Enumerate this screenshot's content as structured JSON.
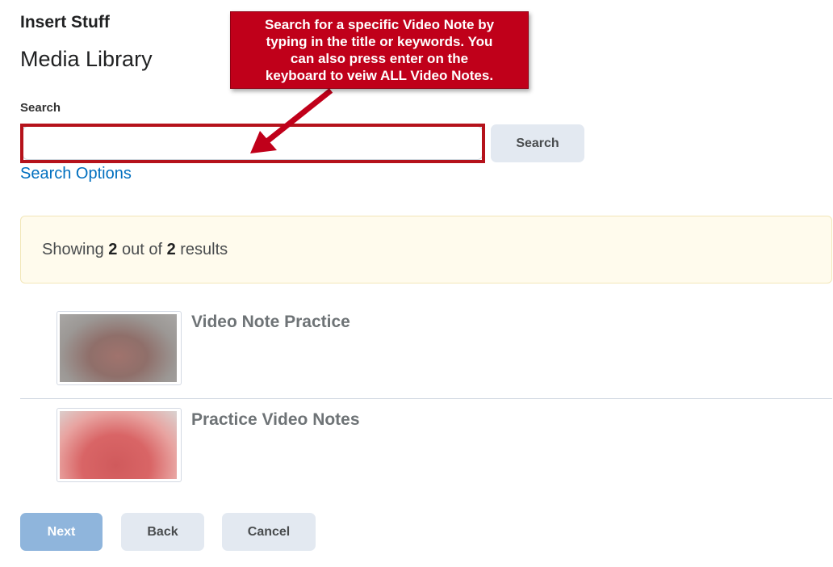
{
  "dialog": {
    "title": "Insert Stuff"
  },
  "page": {
    "title": "Media Library"
  },
  "search": {
    "label": "Search",
    "value": "",
    "placeholder": "",
    "button_label": "Search",
    "options_link": "Search Options"
  },
  "results": {
    "prefix": "Showing",
    "shown": "2",
    "middle": "out of",
    "total": "2",
    "suffix": "results"
  },
  "items": [
    {
      "title": "Video Note Practice",
      "thumbnail": "blurred-video-thumbnail"
    },
    {
      "title": "Practice Video Notes",
      "thumbnail": "blurred-video-thumbnail"
    }
  ],
  "footer": {
    "next_label": "Next",
    "back_label": "Back",
    "cancel_label": "Cancel"
  },
  "callout": {
    "text": "Search for a specific Video Note by\ntyping in the title or keywords. You\ncan also press enter on the\nkeyboard to veiw ALL  Video Notes."
  },
  "colors": {
    "accent": "#006fbf",
    "primary_button": "#8fb5dc",
    "secondary_button": "#e3e9f1",
    "callout_red": "#c0001a",
    "notice_bg": "#fffbed"
  }
}
